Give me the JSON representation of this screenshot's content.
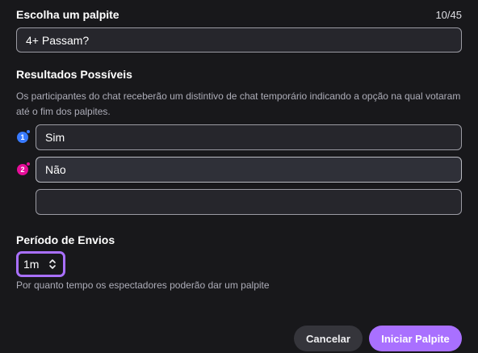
{
  "prompt": {
    "title": "Escolha um palpite",
    "counter": "10/45",
    "value": "4+ Passam?"
  },
  "outcomes": {
    "title": "Resultados Possíveis",
    "description": "Os participantes do chat receberão um distintivo de chat temporário indicando a opção na qual votaram até o fim dos palpites.",
    "options": [
      {
        "index": "1",
        "value": "Sim",
        "color": "#387aff"
      },
      {
        "index": "2",
        "value": "Não",
        "color": "#e60d99"
      },
      {
        "index": "",
        "value": ""
      }
    ]
  },
  "period": {
    "title": "Período de Envios",
    "selected": "1m",
    "hint": "Por quanto tempo os espectadores poderão dar um palpite"
  },
  "actions": {
    "cancel_label": "Cancelar",
    "start_label": "Iniciar Palpite"
  },
  "colors": {
    "background": "#18181b",
    "accent": "#a970ff",
    "outcome_blue": "#387aff",
    "outcome_pink": "#e60d99"
  },
  "icons": [
    "outcome-1-icon",
    "outcome-2-icon",
    "chevron-up-down-icon"
  ]
}
